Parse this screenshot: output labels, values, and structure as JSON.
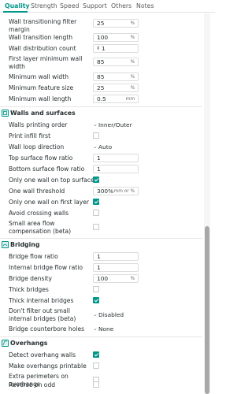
{
  "tabs": [
    "Quality",
    "Strength",
    "Speed",
    "Support",
    "Others",
    "Notes"
  ],
  "rows_top": [
    {
      "label": "Wall transitioning filter margin",
      "value": "25",
      "unit": "%"
    },
    {
      "label": "Wall transition length",
      "value": "100",
      "unit": "%"
    },
    {
      "label": "Wall distribution count",
      "value": "1",
      "unit": ""
    },
    {
      "label": "First layer minimum wall width",
      "value": "85",
      "unit": "%"
    },
    {
      "label": "Minimum wall width",
      "value": "85",
      "unit": "%"
    },
    {
      "label": "Minimum feature size",
      "value": "25",
      "unit": "%"
    },
    {
      "label": "Minimum wall length",
      "value": "0.5",
      "unit": "mm"
    }
  ],
  "walls": {
    "title": "Walls and surfaces",
    "walls_printing_order": {
      "label": "Walls printing order",
      "value": "Inner/Outer"
    },
    "print_infill_first": {
      "label": "Print infill first"
    },
    "wall_loop_direction": {
      "label": "Wall loop direction",
      "value": "Auto"
    },
    "top_surface_flow_ratio": {
      "label": "Top surface flow ratio",
      "value": "1"
    },
    "bottom_surface_flow_ratio": {
      "label": "Bottom surface flow ratio",
      "value": "1"
    },
    "only_one_wall_top": {
      "label": "Only one wall on top surfaces"
    },
    "one_wall_threshold": {
      "label": "One wall threshold",
      "value": "300%",
      "unit": "mm or %"
    },
    "only_one_wall_first": {
      "label": "Only one wall on first layer"
    },
    "avoid_crossing": {
      "label": "Avoid crossing walls"
    },
    "small_area_flow": {
      "label": "Small area flow compensation (beta)"
    }
  },
  "bridging": {
    "title": "Bridging",
    "bridge_flow_ratio": {
      "label": "Bridge flow ratio",
      "value": "1"
    },
    "internal_bridge_flow_ratio": {
      "label": "Internal bridge flow ratio",
      "value": "1"
    },
    "bridge_density": {
      "label": "Bridge density",
      "value": "100",
      "unit": "%"
    },
    "thick_bridges": {
      "label": "Thick bridges"
    },
    "thick_internal_bridges": {
      "label": "Thick internal bridges"
    },
    "dont_filter": {
      "label": "Don't filter out small internal bridges (beta)",
      "value": "Disabled"
    },
    "counterbore": {
      "label": "Bridge counterbore holes",
      "value": "None"
    }
  },
  "overhangs": {
    "title": "Overhangs",
    "detect_overhang_walls": {
      "label": "Detect overhang walls"
    },
    "make_printable": {
      "label": "Make overhangs printable"
    },
    "extra_perimeters": {
      "label": "Extra perimeters on overhangs"
    },
    "reverse_on_odd": {
      "label": "Reverse on odd"
    }
  },
  "colors": {
    "accent": "#009688"
  }
}
